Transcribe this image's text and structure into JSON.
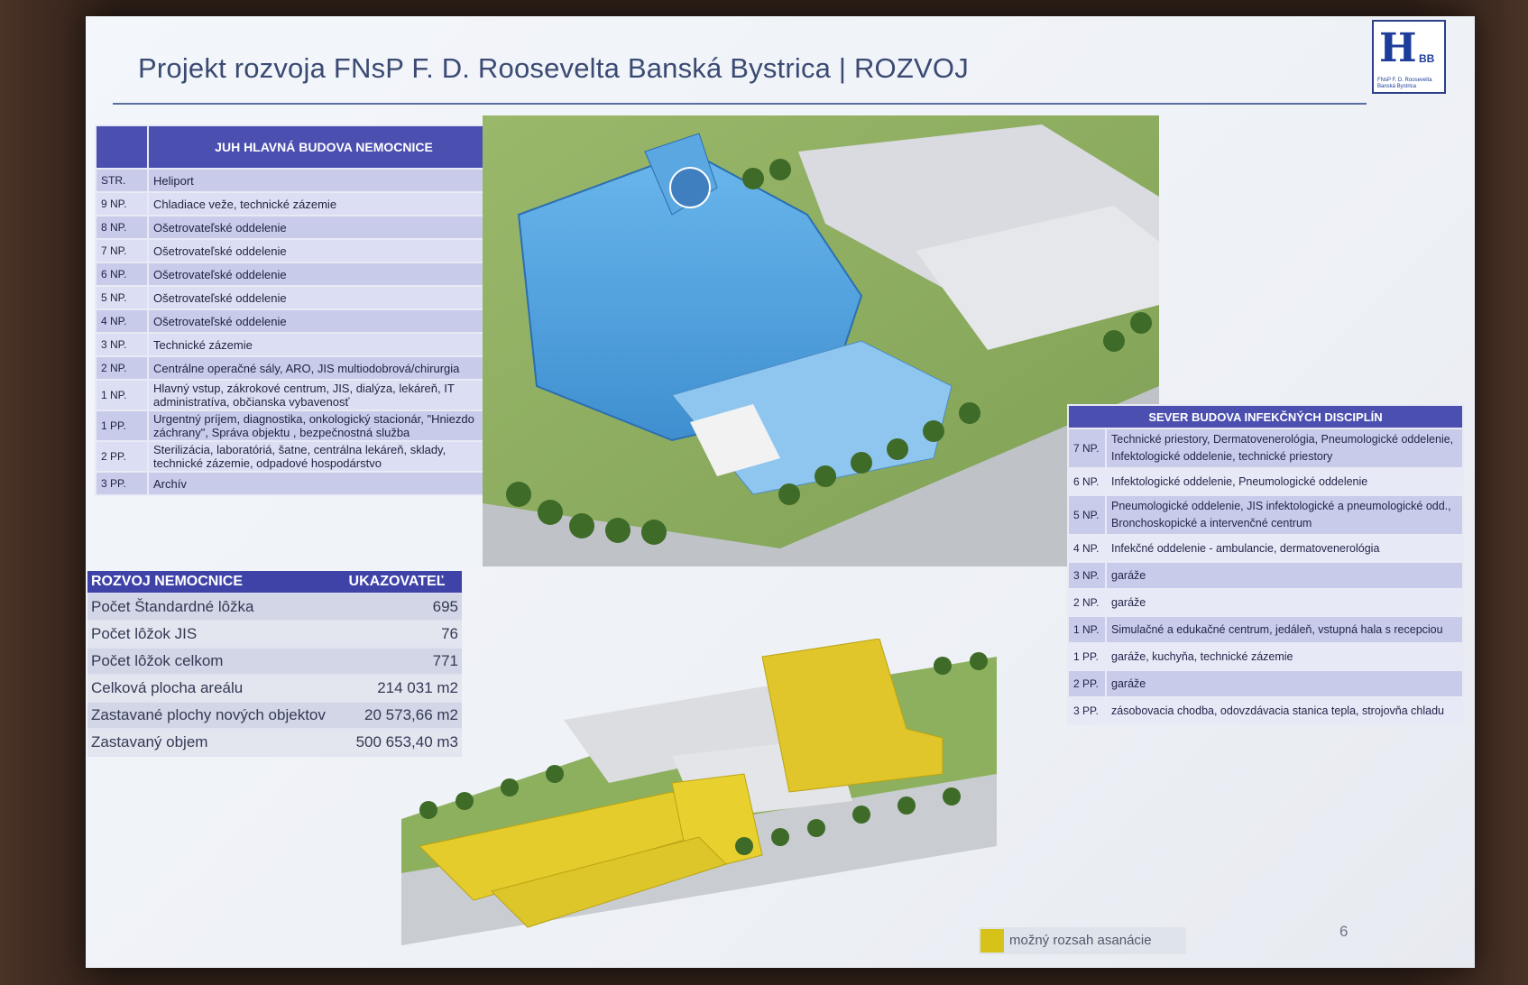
{
  "slide": {
    "title": "Projekt rozvoja FNsP F. D. Roosevelta Banská Bystrica |  ROZVOJ",
    "logo_mark": "H",
    "logo_bb": "BB",
    "logo_sub": "FNsP F. D. Roosevelta Banská Bystrica",
    "page_number": "6",
    "legend_label": "možný rozsah asanácie",
    "legend_color": "#d7c21a"
  },
  "south_table": {
    "header": "JUH   HLAVNÁ BUDOVA NEMOCNICE",
    "rows": [
      {
        "floor": "STR.",
        "desc": "Heliport"
      },
      {
        "floor": "9 NP.",
        "desc": "Chladiace veže, technické zázemie"
      },
      {
        "floor": "8 NP.",
        "desc": "Ošetrovateľské oddelenie"
      },
      {
        "floor": "7 NP.",
        "desc": "Ošetrovateľské oddelenie"
      },
      {
        "floor": "6 NP.",
        "desc": "Ošetrovateľské oddelenie"
      },
      {
        "floor": "5 NP.",
        "desc": "Ošetrovateľské oddelenie"
      },
      {
        "floor": "4 NP.",
        "desc": "Ošetrovateľské oddelenie"
      },
      {
        "floor": "3 NP.",
        "desc": "Technické zázemie"
      },
      {
        "floor": "2 NP.",
        "desc": "Centrálne operačné sály, ARO, JIS multiodobrová/chirurgia"
      },
      {
        "floor": "1 NP.",
        "desc": "Hlavný vstup, zákrokové centrum, JIS, dialýza, lekáreň, IT administratíva, občianska vybavenosť"
      },
      {
        "floor": "1 PP.",
        "desc": "Urgentný príjem, diagnostika, onkologický stacionár, \"Hniezdo záchrany\", Správa objektu , bezpečnostná služba"
      },
      {
        "floor": "2 PP.",
        "desc": "Sterilizácia, laboratóriá, šatne, centrálna lekáreň, sklady, technické zázemie, odpadové hospodárstvo"
      },
      {
        "floor": "3 PP.",
        "desc": "Archív"
      }
    ]
  },
  "dev_table": {
    "col1": "ROZVOJ NEMOCNICE",
    "col2": "UKAZOVATEĽ",
    "rows": [
      {
        "label": "Počet Štandardné lôžka",
        "value": "695"
      },
      {
        "label": "Počet lôžok JIS",
        "value": "76"
      },
      {
        "label": "Počet lôžok celkom",
        "value": "771"
      },
      {
        "label": "Celková plocha areálu",
        "value": "214 031 m2"
      },
      {
        "label": "Zastavané plochy nových objektov",
        "value": "20 573,66 m2"
      },
      {
        "label": "Zastavaný objem",
        "value": "500 653,40 m3"
      }
    ]
  },
  "north_table": {
    "header": "SEVER BUDOVA  INFEKČNÝCH  DISCIPLÍN",
    "rows": [
      {
        "floor": "7 NP.",
        "desc": "Technické priestory, Dermatovenerológia, Pneumologické oddelenie, Infektologické oddelenie, technické priestory"
      },
      {
        "floor": "6 NP.",
        "desc": "Infektologické oddelenie, Pneumologické oddelenie"
      },
      {
        "floor": "5 NP.",
        "desc": "Pneumologické oddelenie, JIS infektologické a pneumologické odd., Bronchoskopické a intervenčné centrum"
      },
      {
        "floor": "4 NP.",
        "desc": "Infekčné oddelenie - ambulancie, dermatovenerológia"
      },
      {
        "floor": "3 NP.",
        "desc": "garáže"
      },
      {
        "floor": "2 NP.",
        "desc": "garáže"
      },
      {
        "floor": "1 NP.",
        "desc": "Simulačné a edukačné centrum, jedáleň, vstupná hala s recepciou"
      },
      {
        "floor": "1 PP.",
        "desc": "garáže, kuchyňa, technické zázemie"
      },
      {
        "floor": "2 PP.",
        "desc": "garáže"
      },
      {
        "floor": "3 PP.",
        "desc": "zásobovacia chodba, odovzdávacia stanica tepla, strojovňa chladu"
      }
    ]
  }
}
